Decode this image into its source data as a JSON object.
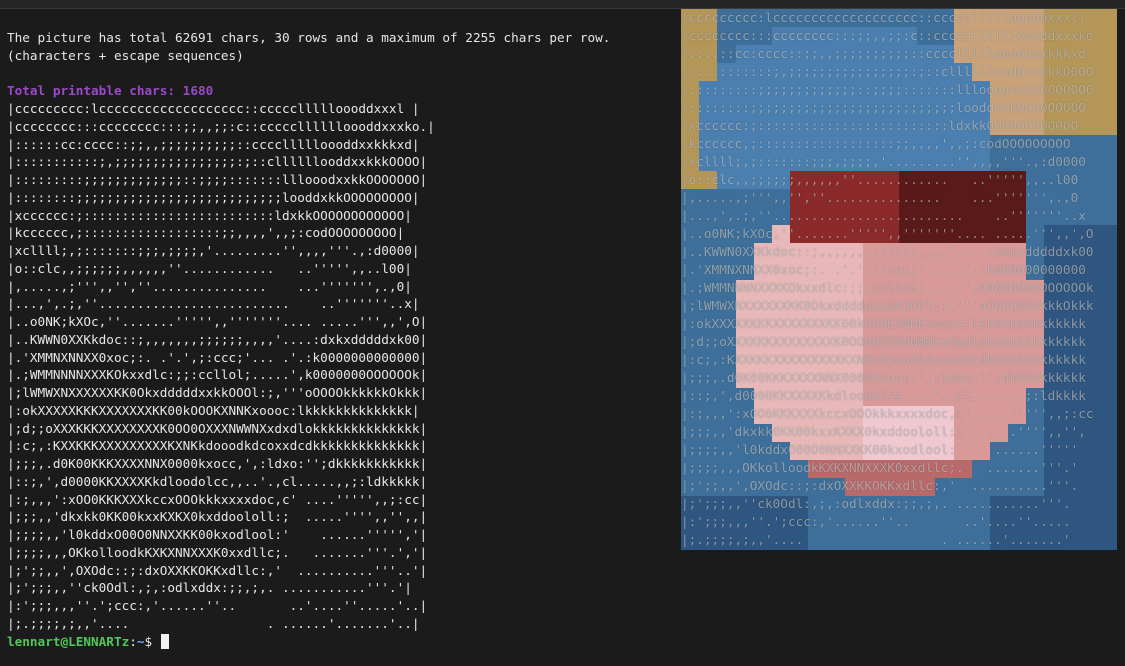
{
  "terminal": {
    "stats_line_1": "The picture has total 62691 chars, 30 rows and a maximum of 2255 chars per row.",
    "stats_line_2": "(characters + escape sequences)",
    "total_printable": "Total printable chars: 1680",
    "art_lines": [
      "|ccccccccc:lccccccccccccccccccc::cccccllllloooddxxxl |",
      "|cccccccc:::cccccccc:::;;,,;;:c::ccccclllllloooddxxxko.|",
      "|::::::cc:cccc::;;,,;;;;;;;;;;::ccccllllloooddxxkkkxd|",
      "|:::::::::::;,;;;;;;;;;;;;;;;;:;::cllllllooddxxkkkOOOO|",
      "|:::::::::;;;;;;;;;;;;;::;;;;:::::::lllooodxxkkOOOOOOO|",
      "|::::::::;;;;;;;;;;;;;;;;;;;;;;;;;;;looddxkkOOOOOOOOO|",
      "|xcccccc:;:::::::::::::::::::::::::ldxkkOOOOOOOOOOOO|",
      "|kcccccc,;::::::::::::::::::;;,,,,',,;:codOOOOOOOOO|",
      "|xcllll;,;:::::::;;;,;;;;,'.........'',,,,'''.,:d0000|",
      "|o::clc,,;;;;;;,,,,,,''............   ..''''',,..l00|",
      "|,.....,;''',,'',''...............    ...''''''',.,0|",
      "|...,',.;,''.........................    ..'''''''..x|",
      "|..o0NK;kXOc,''.......''''',,'''''''.... .....''',,',O|",
      "|..KWWN0XXKkdoc::;,,,,,,,;;;;;;,,,,'....:dxkxdddddxk00|",
      "|.'XMMNXNNXX0xoc;:. .'.',;:ccc;'... .'.:k0000000000000|",
      "|.;WMMNNNNXXXKOkxxdlc:;;:ccllol;.....',k0000000OOOOOOk|",
      "|;lWMWXNXXXXXXKK0OkxdddddxxkkOOOl:;,'''oOOOOkkkkkkOkkk|",
      "|:okXXXXXKKKXXXXXXXKK00kOOOKXNNKxoooc:lkkkkkkkkkkkkkk|",
      "|;d;;oXXXKKKXXXXXXXXK0OO0OXXXNWWNXxdxdlokkkkkkkkkkkkkk|",
      "|:c;,:KXXKKKXXXXXXXXXKXNKkdooodkdcoxxdcdkkkkkkkkkkkkkk|",
      "|;;;,.d0K00KKKXXXXNNX0000kxocc,',:ldxo:'';dkkkkkkkkkkk|",
      "|::;,',d0000KKXXXXKkdloodolcc,,..'.,cl.....,,;:ldkkkkk|",
      "|:;,,,':xOO0KKKXXXkccxOOOkkkxxxxdoc,c' ....''''',,;:cc|",
      "|;;;,,'dkxkk0KK00kxxKXKX0kxddoololl:;  .....'''',,'',,|",
      "|;;;;,,'l0kddxO00O0NNXXKK00kxodlool:'    ......''''','|",
      "|;;;;,,,OKkolloodkKXKXNNXXXK0xxdllc;.   .......'''.','|",
      "|;';;,,',OXOdc::;:dxOXXKKOKKxdllc:,'  ..........'''..'|",
      "|;';;;,,''ck0Odl:,;,:odlxddx:;;,;,. ...........'''.'|",
      "|:';;;,,,''.';ccc:,'......''..       ..'....''.....'..|",
      "|;.;;;;,;,,'....                  . ......'.......'..|"
    ],
    "prompt": {
      "user_host": "lennart@LENNARTz",
      "separator": ":",
      "path": "~",
      "symbol": "$ "
    }
  },
  "preview": {
    "colors": {
      "sky_blue": "#3d6f9a",
      "hat_blue": "#4a7fb0",
      "gold": "#b49658",
      "tan": "#c9a27a",
      "skin_light": "#e8b8b8",
      "skin_mid": "#d89a98",
      "skin_dark": "#b86a6a",
      "red": "#8a2a2a",
      "dark_red": "#5a1a1a",
      "pink": "#f0c8d0",
      "coat_blue": "#2e5680"
    },
    "text_lines": [
      "|ccccccccc:lccccccccccccccccccc::cccccllllloooddxxxl|",
      "|cccccccc:::cccccccc:::;;,,;;:c::ccccclllllloooddxxxko",
      "|::::::cc:cccc::;;,,;;;;;;;;;;::ccccllllloooddxxkkkxd",
      "|:::::::::::;,;;;;;;;;;;;;;;;;:;::cllllllooddxxkkkOOOO",
      "|:::::::::;;;;;;;;;;;;;::;;;;:::::::lllooodxxkkOOOOOOO",
      "|::::::::;;;;;;;;;;;;;;;;;;;;;;;;;;;looddxkkOOOOOOOOO",
      "|xcccccc:;:::::::::::::::::::::::::ldxkkOOOOOOOOOOOO",
      "|kcccccc,;::::::::::::::::::;;,,,,',,;:codOOOOOOOOO",
      "|xcllll;,;:::::::;;;,;;;;,'.........'',,,,'''.,:d0000",
      "|o::clc,,;;;;;;,,,,,,''............   ..''''',,..l00",
      "|,.....,;''',,'',''...............    ...''''''',.,0",
      "|...,',.;,''.........................    ..'''''''..x",
      "|..o0NK;kXOc,''.......''''',,'''''''.... .....''',,',O",
      "|..KWWN0XXKkdoc::;,,,,,,,;;;;;;,,,,'....:dxkxdddddxk00",
      "|.'XMMNXNNXX0xoc;:. .'.',;:ccc;'... .'.:k000000000000",
      "|.;WMMNNNNXXXKOkxxdlc:;;:ccllol;.....',k0000000OOOOOOk",
      "|;lWMWXNXXXXXXKK0OkxdddddxxkkOOOl:;,'''oOOOOkkkkkkOkkk",
      "|:okXXXXXKKKXXXXXXXKK00kOOOKXNNKxoooc:lkkkkkkkkkkkkkk",
      "|;d;;oXXXKKKXXXXXXXXK0OO0OXXXNWWNXxdxdlokkkkkkkkkkkkk",
      "|:c;,:KXXKKKXXXXXXXXXKXNKkdooodkdcoxxdcdkkkkkkkkkkkkk",
      "|;;;,.d0K00KKKXXXXNNX0000kxocc,',:ldxo:'';dkkkkkkkkkk",
      "|::;,',d0000KKXXXXKkdloodolcc,,..'.,cl.....,,;:ldkkkk",
      "|:;,,,':xOO0KKKXXXkccxOOOkkkxxxxdoc,c' ....''''',,;:cc",
      "|;;;,,'dkxkk0KK00kxxKXKX0kxddoololl:;  .....'''',,'',",
      "|;;;;,,'l0kddxO00O0NNXXKK00kxodlool:'    ......'''''",
      "|;;;;,,,OKkolloodkKXKXNNXXXK0xxdllc;.   .......'''.'",
      "|;';;,,',OXOdc::;:dxOXXKKOKKxdllc:,'  ..........'''.",
      "|;';;;,,''ck0Odl:,;,:odlxddx:;;,;,. ...........'''.",
      "|:';;;,,,''.';ccc:,'......''..       ..'....''.....",
      "|;.;;;;,;,,'....                  . ......'.......'"
    ]
  }
}
